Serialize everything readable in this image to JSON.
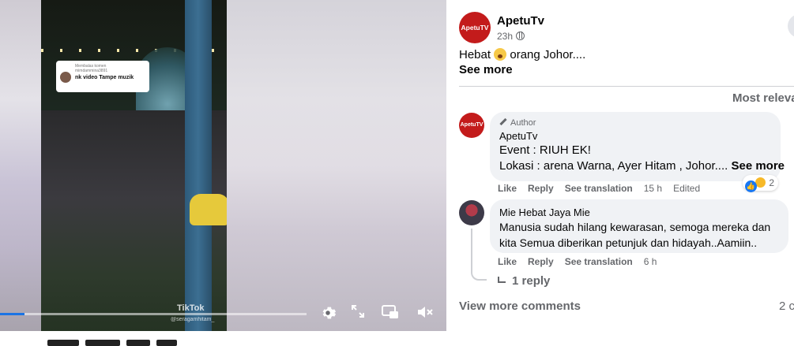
{
  "video": {
    "comment_overlay_small_1": "Membalas komen",
    "comment_overlay_small_2": "mimdammina3891",
    "comment_overlay_main": "nk video Tampe muzik",
    "watermark_brand": "TikTok",
    "watermark_user": "@seragamhitam_",
    "progress_fraction": 0.08,
    "controls": {
      "settings_icon": "gear-icon",
      "fullscreen_icon": "expand-icon",
      "pip_icon": "picture-in-picture-icon",
      "volume_icon": "muted-speaker-icon"
    }
  },
  "post": {
    "author": "ApetuTv",
    "avatar_text": "ApetuTV",
    "time": "23h",
    "caption_before_emoji": "Hebat",
    "caption_after_emoji": "orang Johor....",
    "see_more": "See more",
    "sort_label": "Most releva"
  },
  "comments": [
    {
      "badge": "Author",
      "name": "ApetuTv",
      "avatar_text": "ApetuTV",
      "line1": "Event : RIUH EK!",
      "line2": "Lokasi : arena Warna, Ayer Hitam , Johor....",
      "see_more": "See more",
      "like": "Like",
      "reply": "Reply",
      "translate": "See translation",
      "time": "15 h",
      "edited": "Edited",
      "reaction_count": "2"
    },
    {
      "name": "Mie Hebat Jaya Mie",
      "line1": "Manusia sudah hilang kewarasan, semoga mereka dan",
      "line2": "kita Semua diberikan petunjuk dan hidayah..Aamiin..",
      "like": "Like",
      "reply": "Reply",
      "translate": "See translation",
      "time": "6 h",
      "replies": "1 reply"
    }
  ],
  "footer": {
    "view_more": "View more comments",
    "count": "2 c"
  }
}
